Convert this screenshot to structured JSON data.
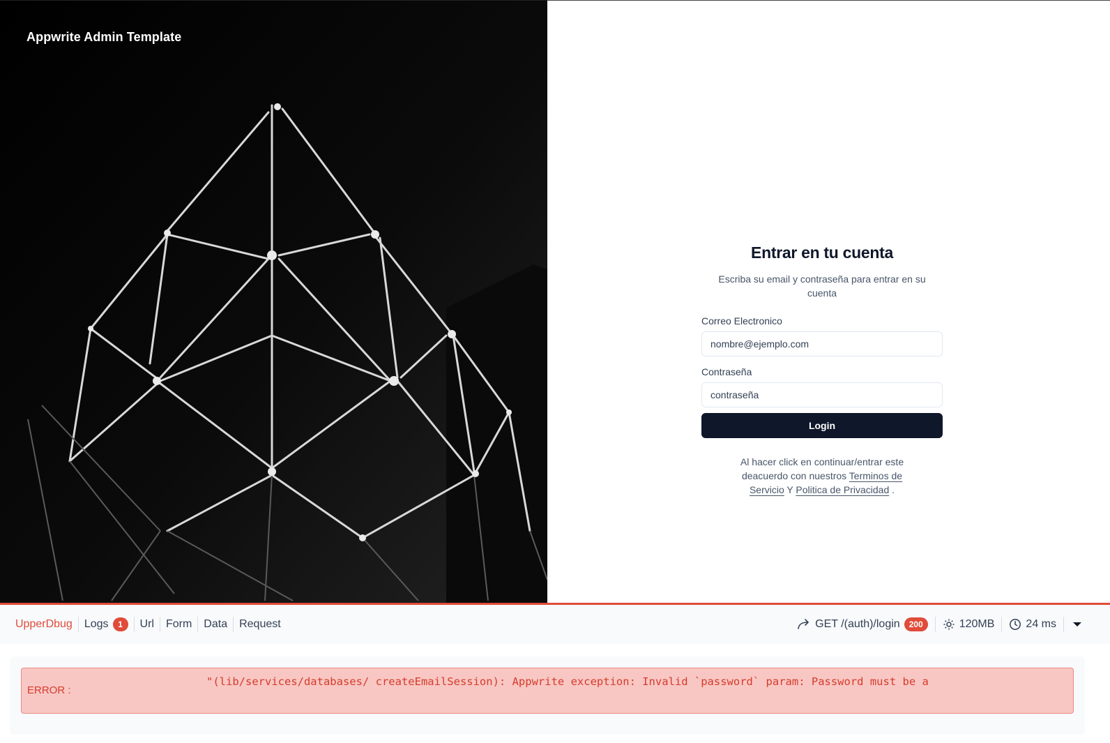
{
  "hero": {
    "brand": "Appwrite Admin Template"
  },
  "login": {
    "title": "Entrar en tu cuenta",
    "subtitle": "Escriba su email y contraseña para entrar en su cuenta",
    "email_label": "Correo Electronico",
    "email_placeholder": "nombre@ejemplo.com",
    "password_label": "Contraseña",
    "password_placeholder": "contraseña",
    "submit_label": "Login",
    "terms_prefix": "Al hacer click en continuar/entrar este deacuerdo con nuestros ",
    "terms_link": "Terminos de Servicio",
    "terms_and": " Y ",
    "privacy_link": "Politica de Privacidad",
    "terms_suffix": " ."
  },
  "debugbar": {
    "brand": "UpperDbug",
    "tabs": [
      {
        "label": "Logs",
        "badge": "1"
      },
      {
        "label": "Url"
      },
      {
        "label": "Form"
      },
      {
        "label": "Data"
      },
      {
        "label": "Request"
      }
    ],
    "request": "GET /(auth)/login",
    "status": "200",
    "memory": "120MB",
    "duration": "24 ms",
    "error_label": "ERROR :",
    "error_message": "\"(lib/services/databases/ createEmailSession): Appwrite exception: Invalid `password` param: Password must be a"
  },
  "colors": {
    "accent_red": "#e04b3a",
    "button_dark": "#0f172a",
    "error_bg": "#f8c7c3"
  }
}
